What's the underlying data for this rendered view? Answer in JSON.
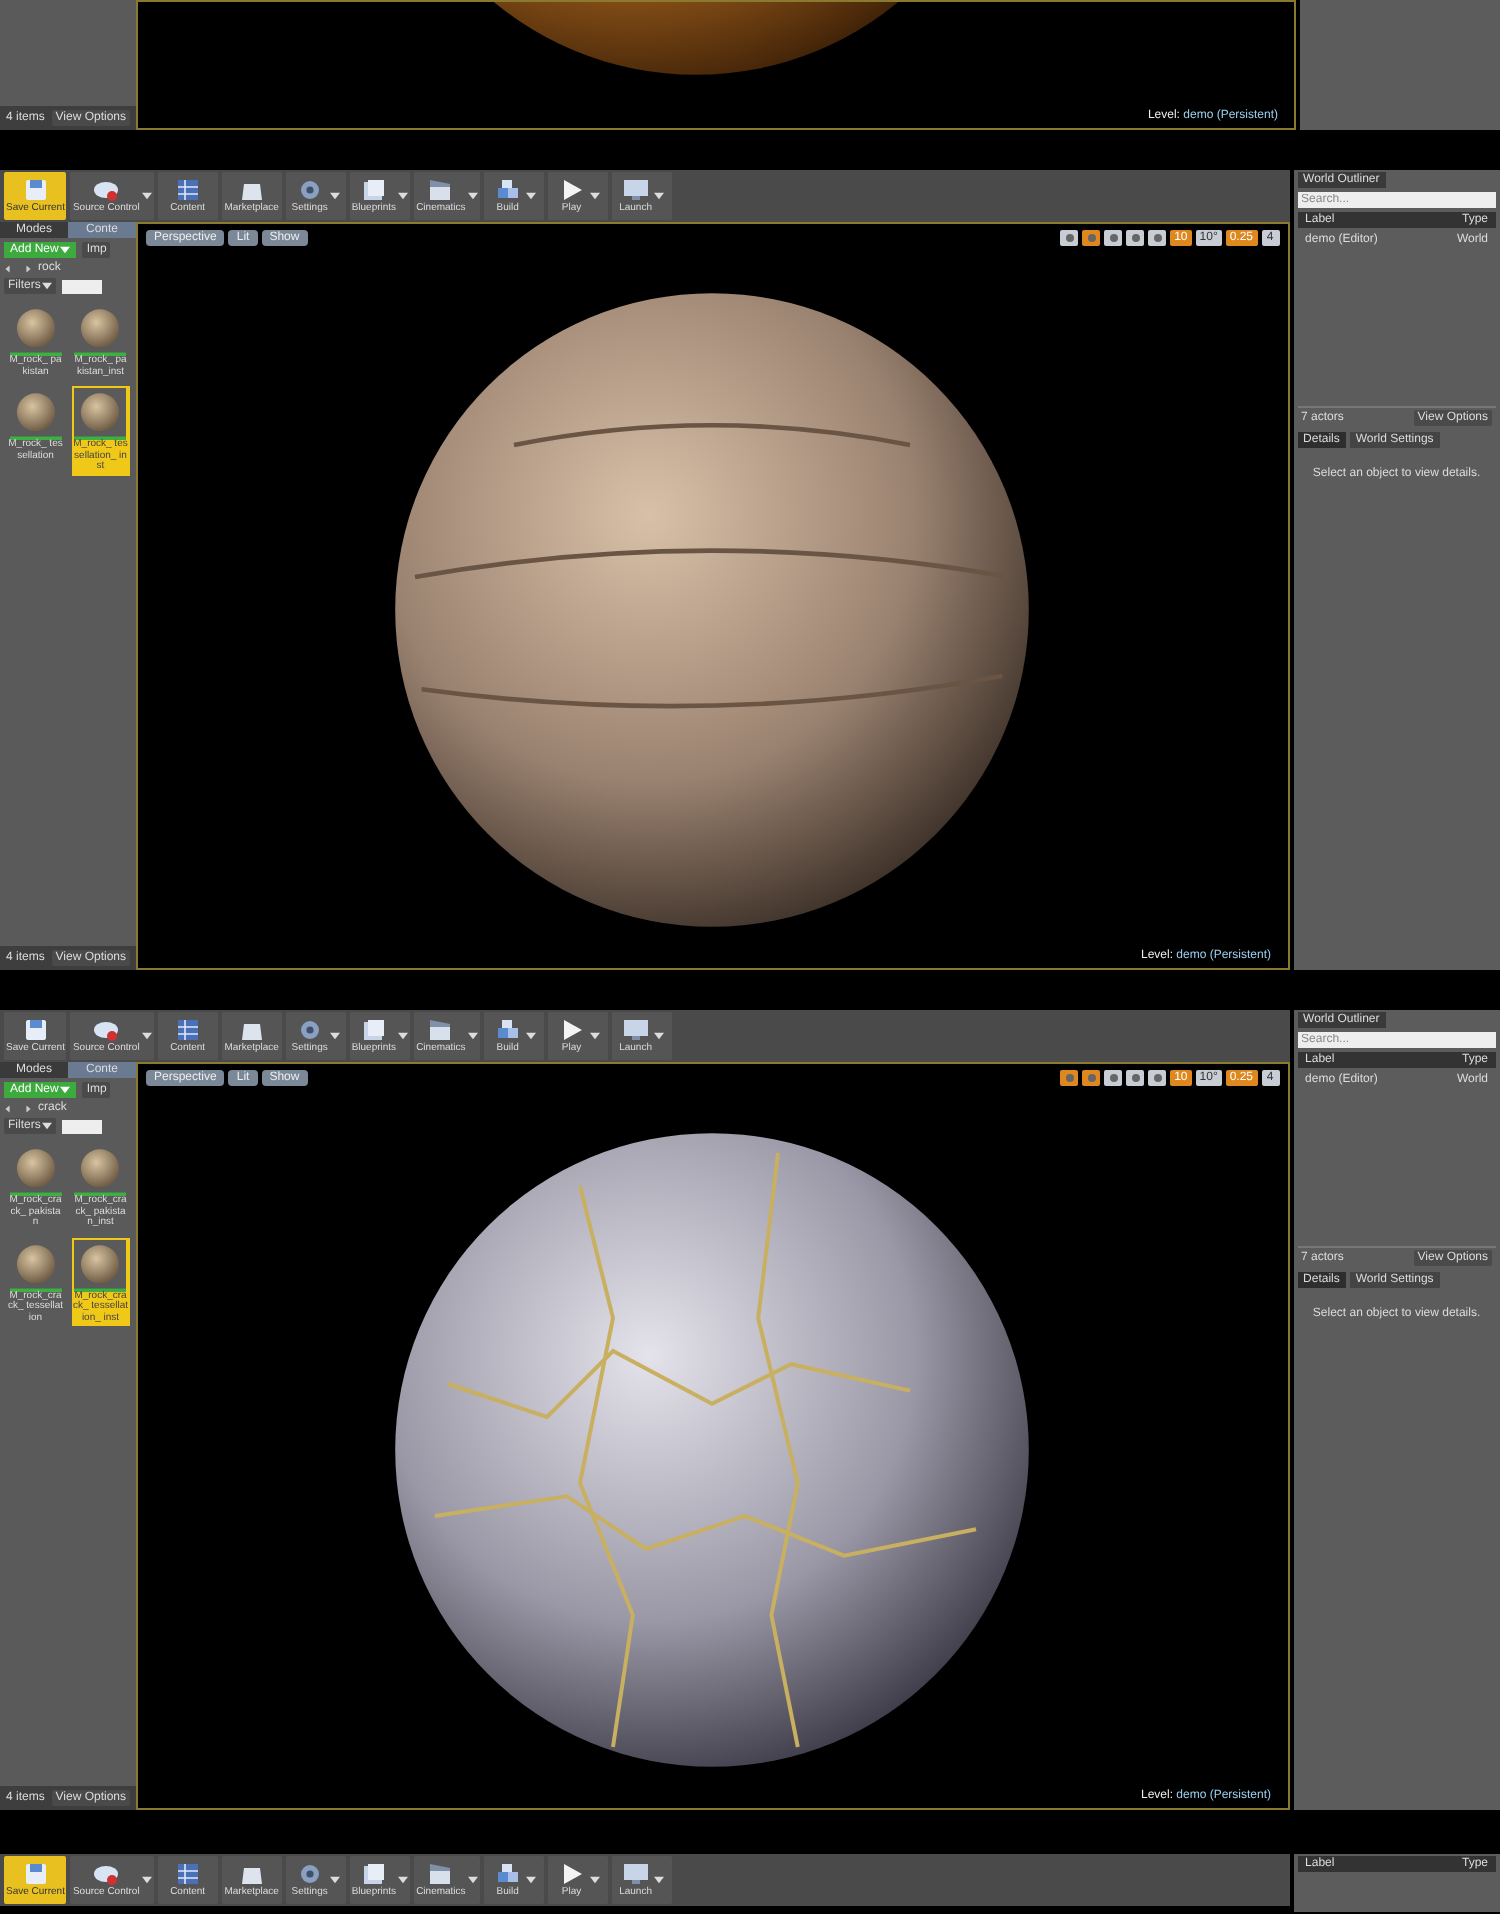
{
  "panels": [
    {
      "kind": "tail",
      "content_browser": {
        "count": "4 items",
        "view_options": "View Options"
      },
      "viewport": {
        "level_label": "Level:",
        "level_name": "demo (Persistent)"
      }
    },
    {
      "kind": "full",
      "toolbar": [
        {
          "label": "Save Current",
          "selected": true,
          "menu": false
        },
        {
          "label": "Source Control",
          "selected": false,
          "menu": true
        },
        {
          "label": "Content",
          "selected": false,
          "menu": false
        },
        {
          "label": "Marketplace",
          "selected": false,
          "menu": false
        },
        {
          "label": "Settings",
          "selected": false,
          "menu": true
        },
        {
          "label": "Blueprints",
          "selected": false,
          "menu": true
        },
        {
          "label": "Cinematics",
          "selected": false,
          "menu": true
        },
        {
          "label": "Build",
          "selected": false,
          "menu": true
        },
        {
          "label": "Play",
          "selected": false,
          "menu": true
        },
        {
          "label": "Launch",
          "selected": false,
          "menu": true
        }
      ],
      "content_browser": {
        "tabs": [
          {
            "label": "Modes",
            "selected": false
          },
          {
            "label": "Conte",
            "selected": true
          }
        ],
        "add_new": "Add New",
        "import": "Imp",
        "folder": "rock",
        "filters": "Filters",
        "assets": [
          {
            "name": "M_rock_ pakistan",
            "selected": false
          },
          {
            "name": "M_rock_ pakistan_inst",
            "selected": false
          },
          {
            "name": "M_rock_ tessellation",
            "selected": false
          },
          {
            "name": "M_rock_ tessellation_ inst",
            "selected": true
          }
        ],
        "count": "4 items",
        "view_options": "View Options"
      },
      "viewport": {
        "view_buttons": [
          "Perspective",
          "Lit",
          "Show"
        ],
        "snaps": [
          {
            "on": false
          },
          {
            "on": true
          },
          {
            "on": false
          },
          {
            "on": false
          },
          {
            "on": false
          },
          {
            "on": true,
            "text": "10"
          },
          {
            "on": false,
            "text": "10°"
          },
          {
            "on": true,
            "text": "0.25"
          },
          {
            "on": false,
            "text": "4"
          }
        ],
        "level_label": "Level:",
        "level_name": "demo (Persistent)"
      },
      "outliner": {
        "tab": "World Outliner",
        "search_placeholder": "Search...",
        "columns": [
          "Label",
          "Type"
        ],
        "rows": [
          {
            "label": "demo (Editor)",
            "type": "World"
          }
        ],
        "actors": "7 actors",
        "view_options": "View Options",
        "detail_tabs": [
          {
            "label": "Details",
            "selected": true
          },
          {
            "label": "World Settings",
            "selected": false
          }
        ],
        "message": "Select an object to view details."
      }
    },
    {
      "kind": "full",
      "toolbar": [
        {
          "label": "Save Current",
          "selected": false,
          "menu": false
        },
        {
          "label": "Source Control",
          "selected": false,
          "menu": true
        },
        {
          "label": "Content",
          "selected": false,
          "menu": false
        },
        {
          "label": "Marketplace",
          "selected": false,
          "menu": false
        },
        {
          "label": "Settings",
          "selected": false,
          "menu": true
        },
        {
          "label": "Blueprints",
          "selected": false,
          "menu": true
        },
        {
          "label": "Cinematics",
          "selected": false,
          "menu": true
        },
        {
          "label": "Build",
          "selected": false,
          "menu": true
        },
        {
          "label": "Play",
          "selected": false,
          "menu": true
        },
        {
          "label": "Launch",
          "selected": false,
          "menu": true
        }
      ],
      "content_browser": {
        "tabs": [
          {
            "label": "Modes",
            "selected": false
          },
          {
            "label": "Conte",
            "selected": true
          }
        ],
        "add_new": "Add New",
        "import": "Imp",
        "folder": "crack",
        "filters": "Filters",
        "assets": [
          {
            "name": "M_rock_crack_ pakistan",
            "selected": false
          },
          {
            "name": "M_rock_crack_ pakistan_inst",
            "selected": false
          },
          {
            "name": "M_rock_crack_ tessellation",
            "selected": false
          },
          {
            "name": "M_rock_crack_ tessellation_ inst",
            "selected": true
          }
        ],
        "count": "4 items",
        "view_options": "View Options"
      },
      "viewport": {
        "view_buttons": [
          "Perspective",
          "Lit",
          "Show"
        ],
        "snaps": [
          {
            "on": true
          },
          {
            "on": true
          },
          {
            "on": false
          },
          {
            "on": false
          },
          {
            "on": false
          },
          {
            "on": true,
            "text": "10"
          },
          {
            "on": false,
            "text": "10°"
          },
          {
            "on": true,
            "text": "0.25"
          },
          {
            "on": false,
            "text": "4"
          }
        ],
        "level_label": "Level:",
        "level_name": "demo (Persistent)"
      },
      "outliner": {
        "tab": "World Outliner",
        "search_placeholder": "Search...",
        "columns": [
          "Label",
          "Type"
        ],
        "rows": [
          {
            "label": "demo (Editor)",
            "type": "World"
          }
        ],
        "actors": "7 actors",
        "view_options": "View Options",
        "detail_tabs": [
          {
            "label": "Details",
            "selected": true
          },
          {
            "label": "World Settings",
            "selected": false
          }
        ],
        "message": "Select an object to view details."
      }
    },
    {
      "kind": "head",
      "toolbar": [
        {
          "label": "Save Current",
          "selected": true,
          "menu": false
        },
        {
          "label": "Source Control",
          "selected": false,
          "menu": true
        },
        {
          "label": "Content",
          "selected": false,
          "menu": false
        },
        {
          "label": "Marketplace",
          "selected": false,
          "menu": false
        },
        {
          "label": "Settings",
          "selected": false,
          "menu": true
        },
        {
          "label": "Blueprints",
          "selected": false,
          "menu": true
        },
        {
          "label": "Cinematics",
          "selected": false,
          "menu": true
        },
        {
          "label": "Build",
          "selected": false,
          "menu": true
        },
        {
          "label": "Play",
          "selected": false,
          "menu": true
        },
        {
          "label": "Launch",
          "selected": false,
          "menu": true
        }
      ],
      "outliner": {
        "columns": [
          "Label",
          "Type"
        ]
      }
    }
  ]
}
